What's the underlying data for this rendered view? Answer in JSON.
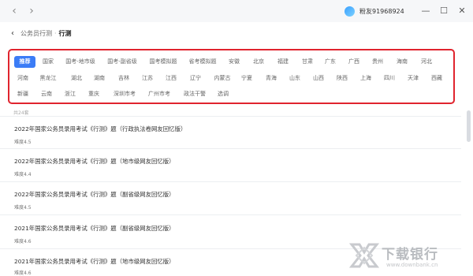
{
  "titlebar": {
    "back_icon": "chevron-left-icon",
    "forward_icon": "chevron-right-icon",
    "username": "粉友91968924",
    "window_buttons": [
      "minimize",
      "restore",
      "close"
    ]
  },
  "breadcrumb": {
    "back_icon": "chevron-left-icon",
    "parent": "公务员行测",
    "separator": "·",
    "current": "行测"
  },
  "filters": {
    "accent_color": "#3b7cf6",
    "highlight_border_color": "#e0242e",
    "rows": [
      [
        "推荐",
        "国家",
        "国考-地市级",
        "国考-副省级",
        "国考模拟题",
        "省考模拟题",
        "安徽",
        "北京",
        "福建",
        "甘肃",
        "广东",
        "广西",
        "贵州",
        "海南",
        "河北"
      ],
      [
        "河南",
        "黑龙江",
        "湖北",
        "湖南",
        "吉林",
        "江苏",
        "江西",
        "辽宁",
        "内蒙古",
        "宁夏",
        "青海",
        "山东",
        "山西",
        "陕西",
        "上海",
        "四川",
        "天津",
        "西藏"
      ],
      [
        "新疆",
        "云南",
        "浙江",
        "重庆",
        "深圳市考",
        "广州市考",
        "政法干警",
        "选调"
      ]
    ],
    "selected": "推荐"
  },
  "list": {
    "count_label": "共24套",
    "items": [
      {
        "title": "2022年国家公务员录用考试《行测》题（行政执法卷网友回忆版）",
        "difficulty": "难度4.5"
      },
      {
        "title": "2022年国家公务员录用考试《行测》题（地市级网友回忆版）",
        "difficulty": "难度4.4"
      },
      {
        "title": "2022年国家公务员录用考试《行测》题（副省级网友回忆版）",
        "difficulty": "难度4.5"
      },
      {
        "title": "2021年国家公务员录用考试《行测》题（副省级网友回忆版）",
        "difficulty": "难度4.6"
      },
      {
        "title": "2021年国家公务员录用考试《行测》题（地市级网友回忆版）",
        "difficulty": "难度4.6"
      }
    ]
  },
  "watermark": {
    "text": "下载银行",
    "url": "www.downbank.cn"
  }
}
